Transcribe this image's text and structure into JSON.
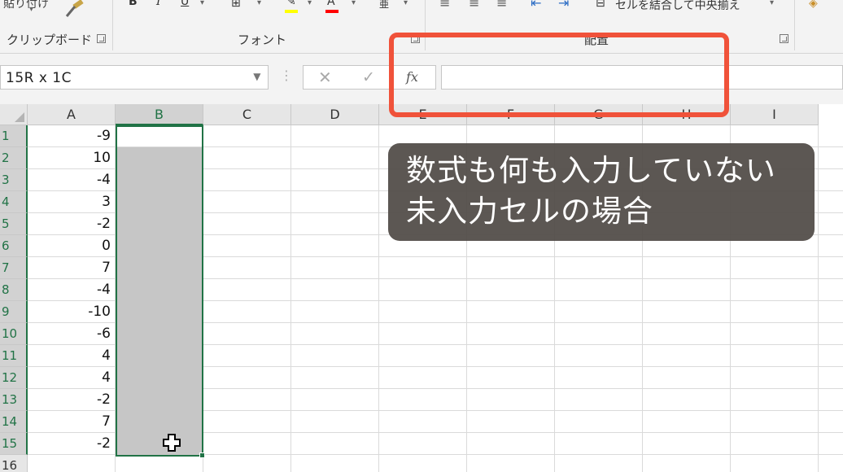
{
  "ribbon": {
    "paste_fragment": "貼り付け",
    "clipboard_label": "クリップボード",
    "font_label": "フォント",
    "alignment_label": "配置",
    "merge_center_label": "セルを結合して中央揃え",
    "bold": "B",
    "italic": "I",
    "underline": "U",
    "font_color_letter": "A",
    "accent_colors": {
      "highlight": "#ffff00",
      "font_color": "#ff0000"
    }
  },
  "formula_bar": {
    "name_box": "15R x 1C",
    "fx": "fx",
    "formula": ""
  },
  "sheet": {
    "columns": [
      "A",
      "B",
      "C",
      "D",
      "E",
      "F",
      "G",
      "H",
      "I"
    ],
    "rows": [
      "1",
      "2",
      "3",
      "4",
      "5",
      "6",
      "7",
      "8",
      "9",
      "10",
      "11",
      "12",
      "13",
      "14",
      "15",
      "16"
    ],
    "column_a_values": [
      "-9",
      "10",
      "-4",
      "3",
      "-2",
      "0",
      "7",
      "-4",
      "-10",
      "-6",
      "4",
      "4",
      "-2",
      "7",
      "-2"
    ],
    "selected_column": "B",
    "selected_rows": "1-15"
  },
  "caption": {
    "line1": "数式も何も入力していない",
    "line2": "未入力セルの場合"
  },
  "colors": {
    "selection_green": "#217346",
    "highlight_red": "#f0523a"
  }
}
